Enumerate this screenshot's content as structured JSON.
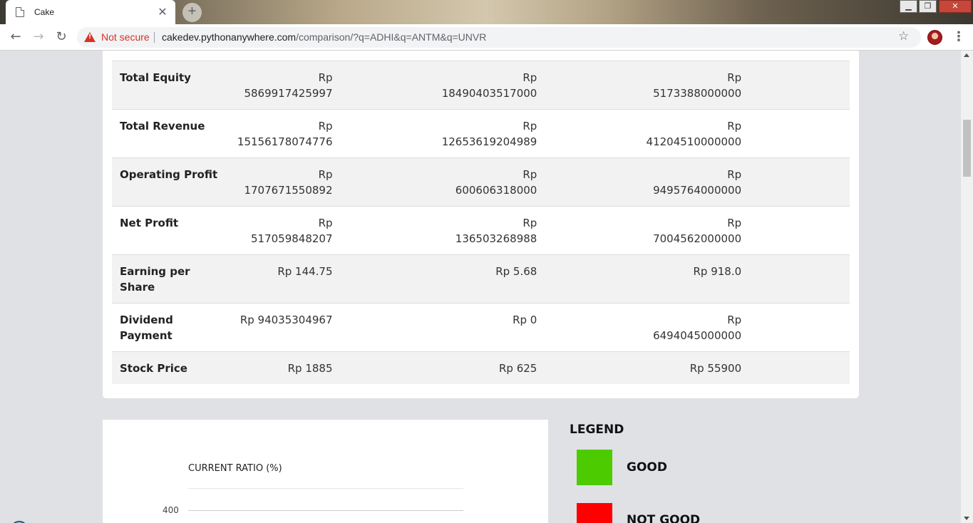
{
  "browser": {
    "tab_title": "Cake",
    "new_tab_symbol": "+",
    "close_tab_symbol": "✕",
    "security_label": "Not secure",
    "url_host": "cakedev.pythonanywhere.com",
    "url_path": "/comparison/?q=ADHI&q=ANTM&q=UNVR",
    "icons": {
      "page": "page-icon",
      "back": "back-arrow-icon",
      "forward": "forward-arrow-icon",
      "reload": "reload-icon",
      "warning": "warning-triangle-icon",
      "star": "star-icon",
      "menu": "kebab-menu-icon"
    },
    "window_controls": {
      "minimize": "▁",
      "maximize": "❐",
      "close": "✕"
    }
  },
  "table": {
    "rows": [
      {
        "label": "Total Equity",
        "values": [
          {
            "line1": "Rp",
            "line2": "5869917425997"
          },
          {
            "line1": "Rp",
            "line2": "18490403517000"
          },
          {
            "line1": "Rp",
            "line2": "5173388000000"
          }
        ]
      },
      {
        "label": "Total Revenue",
        "values": [
          {
            "line1": "Rp",
            "line2": "15156178074776"
          },
          {
            "line1": "Rp",
            "line2": "12653619204989"
          },
          {
            "line1": "Rp",
            "line2": "41204510000000"
          }
        ]
      },
      {
        "label": "Operating Profit",
        "values": [
          {
            "line1": "Rp",
            "line2": "1707671550892"
          },
          {
            "line1": "Rp",
            "line2": "600606318000"
          },
          {
            "line1": "Rp",
            "line2": "9495764000000"
          }
        ]
      },
      {
        "label": "Net Profit",
        "values": [
          {
            "line1": "Rp",
            "line2": "517059848207"
          },
          {
            "line1": "Rp",
            "line2": "136503268988"
          },
          {
            "line1": "Rp",
            "line2": "7004562000000"
          }
        ]
      },
      {
        "label": "Earning per Share",
        "values": [
          {
            "line1": "Rp 144.75",
            "line2": ""
          },
          {
            "line1": "Rp 5.68",
            "line2": ""
          },
          {
            "line1": "Rp 918.0",
            "line2": ""
          }
        ]
      },
      {
        "label": "Dividend Payment",
        "values": [
          {
            "line1": "Rp 94035304967",
            "line2": ""
          },
          {
            "line1": "Rp 0",
            "line2": ""
          },
          {
            "line1": "Rp",
            "line2": "6494045000000"
          }
        ]
      },
      {
        "label": "Stock Price",
        "values": [
          {
            "line1": "Rp 1885",
            "line2": ""
          },
          {
            "line1": "Rp 625",
            "line2": ""
          },
          {
            "line1": "Rp 55900",
            "line2": ""
          }
        ]
      }
    ]
  },
  "chart": {
    "title": "CURRENT RATIO (%)",
    "tick_400": "400"
  },
  "legend": {
    "title": "LEGEND",
    "good_label": "GOOD",
    "good_color": "#4ccc00",
    "bad_label": "NOT GOOD",
    "bad_color": "#ff0000"
  }
}
